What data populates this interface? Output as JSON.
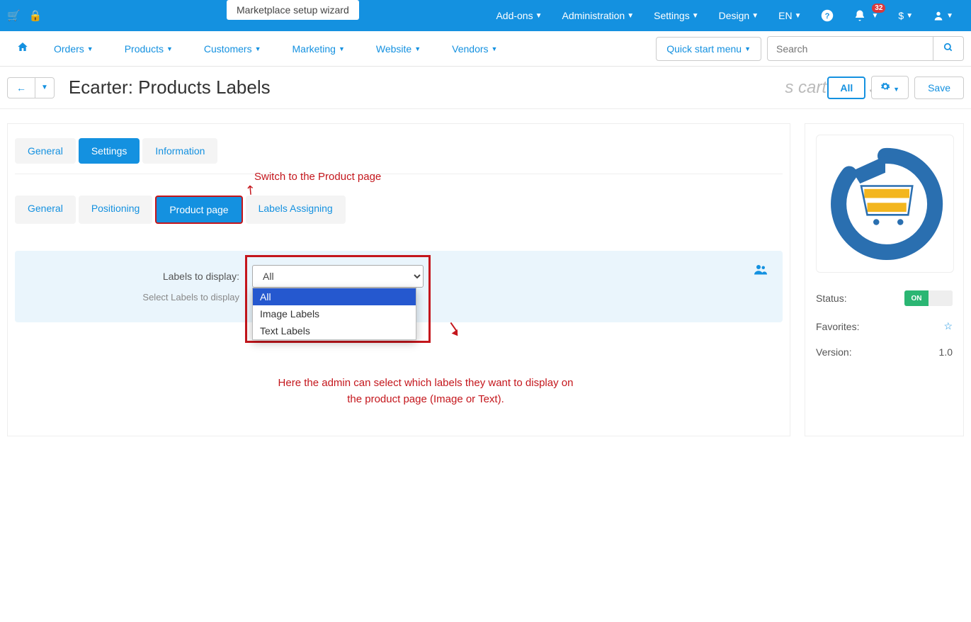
{
  "topbar": {
    "wizard": "Marketplace setup wizard",
    "items": [
      "Add-ons",
      "Administration",
      "Settings",
      "Design",
      "EN",
      "$"
    ],
    "notif_count": "32"
  },
  "nav": {
    "items": [
      "Orders",
      "Products",
      "Customers",
      "Marketing",
      "Website",
      "Vendors"
    ],
    "quick": "Quick start menu",
    "search_placeholder": "Search"
  },
  "title": {
    "heading": "Ecarter: Products Labels",
    "all": "All",
    "save": "Save",
    "ghost": "s cart emo Sto"
  },
  "tabs": {
    "items": [
      "General",
      "Settings",
      "Information"
    ],
    "active": 1
  },
  "subtabs": {
    "items": [
      "General",
      "Positioning",
      "Product page",
      "Labels Assigning"
    ],
    "active": 2
  },
  "annot": {
    "a1": "Switch to the Product page",
    "a2": "Here the admin can select which labels they want to display on the product page (Image or Text)."
  },
  "form": {
    "label": "Labels to display:",
    "sublabel": "Select Labels to display",
    "selected": "All",
    "options": [
      "All",
      "Image Labels",
      "Text Labels"
    ]
  },
  "sidebar": {
    "status": "Status:",
    "status_on": "ON",
    "fav": "Favorites:",
    "ver": "Version:",
    "ver_val": "1.0"
  }
}
